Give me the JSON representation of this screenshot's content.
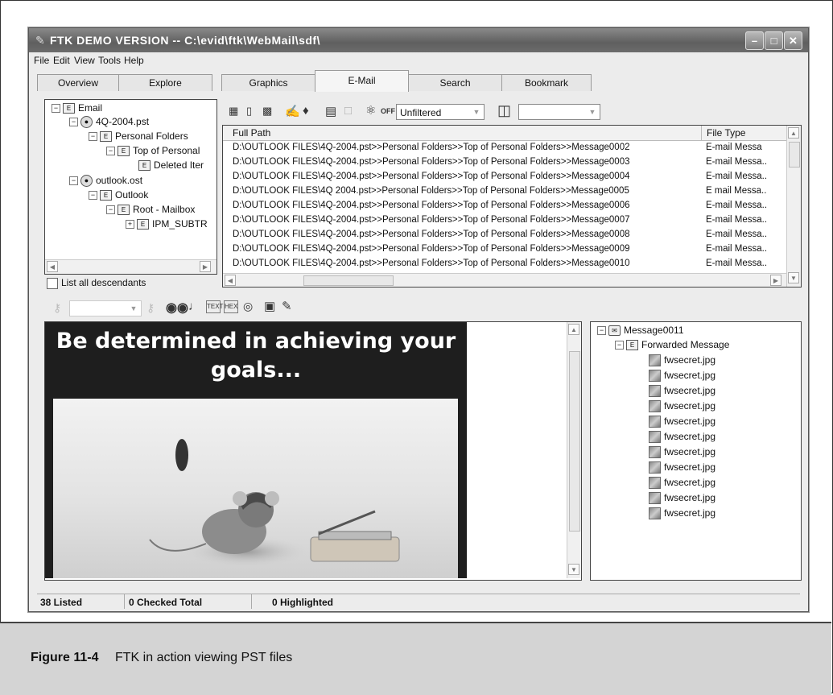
{
  "window": {
    "title": "FTK DEMO VERSION -- C:\\evid\\ftk\\WebMail\\sdf\\"
  },
  "menu": [
    "File",
    "Edit",
    "View",
    "Tools",
    "Help"
  ],
  "tabs": [
    "Overview",
    "Explore",
    "Graphics",
    "E-Mail",
    "Search",
    "Bookmark"
  ],
  "active_tab": "E-Mail",
  "tree": {
    "nodes": [
      "Email",
      "4Q-2004.pst",
      "Personal Folders",
      "Top of Personal",
      "Deleted Iter",
      "outlook.ost",
      "Outlook",
      "Root - Mailbox",
      "IPM_SUBTR"
    ],
    "list_descendants_label": "List all descendants"
  },
  "filter": {
    "off_label": "OFF",
    "filter_value": "Unfiltered"
  },
  "file_list": {
    "columns": [
      "Full Path",
      "File Type"
    ],
    "rows": [
      {
        "path": "D:\\OUTLOOK FILES\\4Q-2004.pst>>Personal Folders>>Top of Personal Folders>>Message0002",
        "type": "E-mail Messa"
      },
      {
        "path": "D:\\OUTLOOK FILES\\4Q-2004.pst>>Personal Folders>>Top of Personal Folders>>Message0003",
        "type": "E-mail Messa.."
      },
      {
        "path": "D:\\OUTLOOK FILES\\4Q-2004.pst>>Personal Folders>>Top of Personal Folders>>Message0004",
        "type": "E-mail Messa.."
      },
      {
        "path": "D:\\OUTLOOK FILES\\4Q 2004.pst>>Personal Folders>>Top of Personal Folders>>Message0005",
        "type": "E mail Messa.."
      },
      {
        "path": "D:\\OUTLOOK FILES\\4Q-2004.pst>>Personal Folders>>Top of Personal Folders>>Message0006",
        "type": "E-mail Messa.."
      },
      {
        "path": "D:\\OUTLOOK FILES\\4Q-2004.pst>>Personal Folders>>Top of Personal Folders>>Message0007",
        "type": "E-mail Messa.."
      },
      {
        "path": "D:\\OUTLOOK FILES\\4Q-2004.pst>>Personal Folders>>Top of Personal Folders>>Message0008",
        "type": "E-mail Messa.."
      },
      {
        "path": "D:\\OUTLOOK FILES\\4Q-2004.pst>>Personal Folders>>Top of Personal Folders>>Message0009",
        "type": "E-mail Messa.."
      },
      {
        "path": "D:\\OUTLOOK FILES\\4Q-2004.pst>>Personal Folders>>Top of Personal Folders>>Message0010",
        "type": "E-mail Messa.."
      }
    ]
  },
  "viewer": {
    "headline": "Be determined in achieving your goals..."
  },
  "attachments": {
    "message": "Message0011",
    "forwarded": "Forwarded Message",
    "files": [
      "fwsecret.jpg",
      "fwsecret.jpg",
      "fwsecret.jpg",
      "fwsecret.jpg",
      "fwsecret.jpg",
      "fwsecret.jpg",
      "fwsecret.jpg",
      "fwsecret.jpg",
      "fwsecret.jpg",
      "fwsecret.jpg",
      "fwsecret.jpg"
    ]
  },
  "status": {
    "listed": "38 Listed",
    "checked": "0 Checked Total",
    "highlighted": "0 Highlighted"
  },
  "caption": {
    "figure": "Figure 11-4",
    "text": "FTK in action viewing PST files"
  }
}
